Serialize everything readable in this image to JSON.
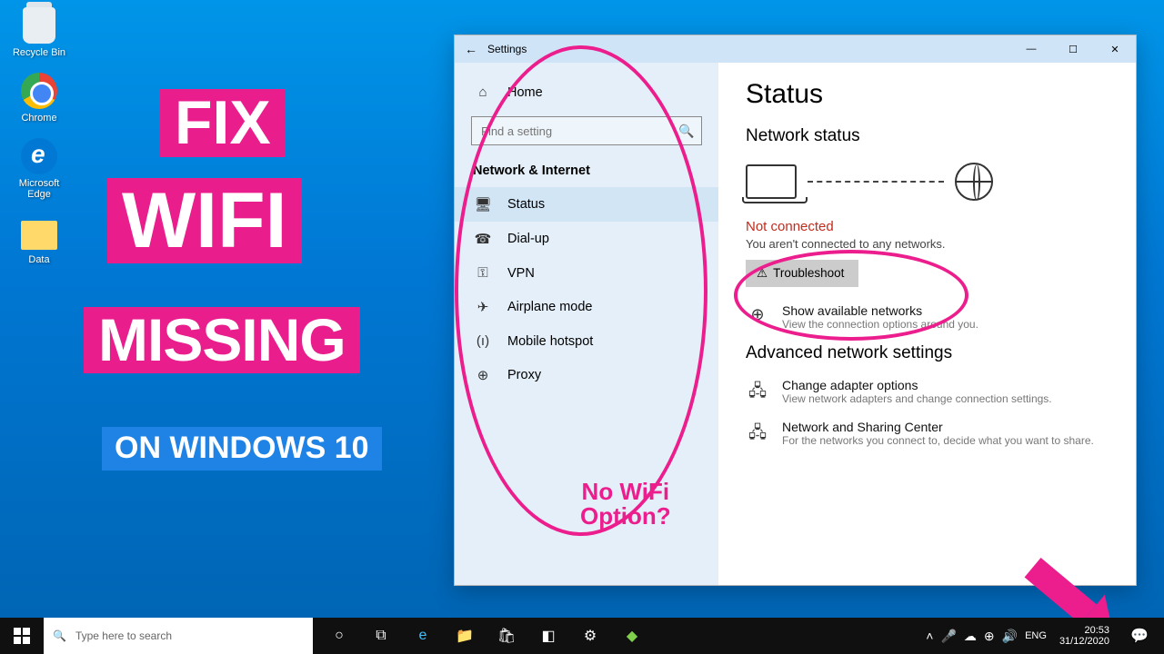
{
  "desktop": {
    "icons": [
      {
        "label": "Recycle Bin"
      },
      {
        "label": "Chrome"
      },
      {
        "label": "Microsoft Edge"
      },
      {
        "label": "Data"
      }
    ]
  },
  "overlay": {
    "line1": "FIX",
    "line2": "WIFI",
    "line3": "MISSING",
    "line4": "ON WINDOWS 10"
  },
  "annotation": {
    "nowifi_line1": "No WiFi",
    "nowifi_line2": "Option?"
  },
  "settings": {
    "title": "Settings",
    "home": "Home",
    "search_placeholder": "Find a setting",
    "category": "Network & Internet",
    "nav": [
      {
        "icon": "⊞",
        "label": "Status"
      },
      {
        "icon": "⌂",
        "label": "Dial-up"
      },
      {
        "icon": "⛨",
        "label": "VPN"
      },
      {
        "icon": "✈",
        "label": "Airplane mode"
      },
      {
        "icon": "(ı)",
        "label": "Mobile hotspot"
      },
      {
        "icon": "⊕",
        "label": "Proxy"
      }
    ],
    "page_title": "Status",
    "section1": "Network status",
    "not_connected_title": "Not connected",
    "not_connected_sub": "You aren't connected to any networks.",
    "troubleshoot": "Troubleshoot",
    "show_networks_title": "Show available networks",
    "show_networks_sub": "View the connection options around you.",
    "advanced_header": "Advanced network settings",
    "adapter_title": "Change adapter options",
    "adapter_sub": "View network adapters and change connection settings.",
    "sharing_title": "Network and Sharing Center",
    "sharing_sub": "For the networks you connect to, decide what you want to share."
  },
  "taskbar": {
    "search_placeholder": "Type here to search",
    "lang": "ENG",
    "time": "20:53",
    "date": "31/12/2020"
  }
}
